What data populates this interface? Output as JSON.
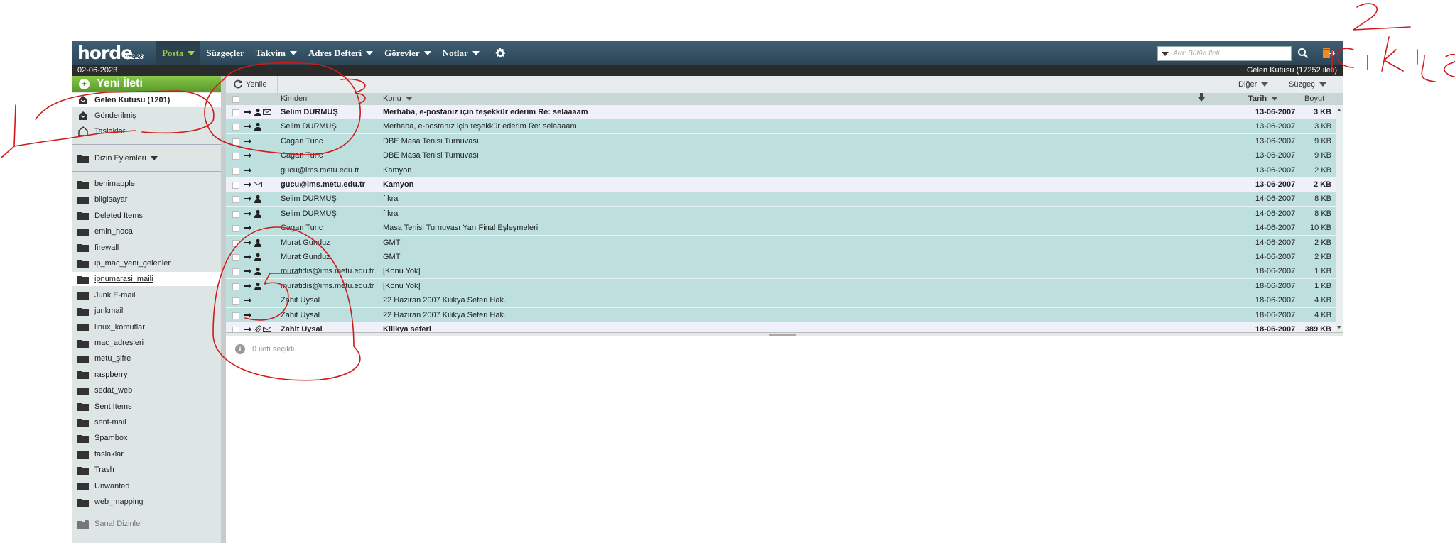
{
  "app": {
    "logo": "horde",
    "version": "5.2.23"
  },
  "nav": {
    "items": [
      {
        "label": "Posta",
        "caret": true,
        "active": true
      },
      {
        "label": "Süzgeçler",
        "caret": false
      },
      {
        "label": "Takvim",
        "caret": true
      },
      {
        "label": "Adres Defteri",
        "caret": true
      },
      {
        "label": "Görevler",
        "caret": true
      },
      {
        "label": "Notlar",
        "caret": true
      }
    ],
    "settings_icon": "gear-icon",
    "search_placeholder": "Ara: Bütün İleti",
    "search_icon": "search-icon",
    "logout_icon": "logout-icon"
  },
  "datebar": {
    "date": "02-06-2023",
    "mailbox_info": "Gelen Kutusu (17252 ileti)"
  },
  "sidebar": {
    "new_message": "Yeni İleti",
    "system_folders": [
      {
        "label": "Gelen Kutusu (1201)",
        "icon": "inbox-icon",
        "bold": true,
        "selected": true
      },
      {
        "label": "Gönderilmiş",
        "icon": "sent-icon"
      },
      {
        "label": "Taslaklar",
        "icon": "drafts-icon"
      }
    ],
    "folder_actions": "Dizin Eylemleri",
    "folders": [
      "benimapple",
      "bilgisayar",
      "Deleted Items",
      "emin_hoca",
      "firewall",
      "ip_mac_yeni_gelenler",
      "ipnumarasi_maili",
      "Junk E-mail",
      "junkmail",
      "linux_komutlar",
      "mac_adresleri",
      "metu_şifre",
      "raspberry",
      "sedat_web",
      "Sent Items",
      "sent-mail",
      "Spambox",
      "taslaklar",
      "Trash",
      "Unwanted",
      "web_mapping"
    ],
    "selected_folder": "ipnumarasi_maili",
    "virtual_folders": "Sanal Dizinler"
  },
  "toolbar": {
    "refresh": "Yenile",
    "other": "Diğer",
    "filter": "Süzgeç"
  },
  "list": {
    "columns": {
      "from": "Kimden",
      "subject": "Konu",
      "date": "Tarih",
      "size": "Boyut"
    },
    "rows": [
      {
        "from": "Selim DURMUŞ",
        "subject": "Merhaba, e-postanız için teşekkür ederim Re: selaaaam",
        "date": "13-06-2007",
        "size": "3 KB",
        "unseen": true,
        "person": true,
        "envelope": true
      },
      {
        "from": "Selim DURMUŞ",
        "subject": "Merhaba, e-postanız için teşekkür ederim Re: selaaaam",
        "date": "13-06-2007",
        "size": "3 KB",
        "person": true
      },
      {
        "from": "Cagan Tunc",
        "subject": "DBE Masa Tenisi Turnuvası",
        "date": "13-06-2007",
        "size": "9 KB"
      },
      {
        "from": "Cagan Tunc",
        "subject": "DBE Masa Tenisi Turnuvası",
        "date": "13-06-2007",
        "size": "9 KB"
      },
      {
        "from": "gucu@ims.metu.edu.tr",
        "subject": "Kamyon",
        "date": "13-06-2007",
        "size": "2 KB"
      },
      {
        "from": "gucu@ims.metu.edu.tr",
        "subject": "Kamyon",
        "date": "13-06-2007",
        "size": "2 KB",
        "unseen": true,
        "envelope": true
      },
      {
        "from": "Selim DURMUŞ",
        "subject": "fıkra",
        "date": "14-06-2007",
        "size": "8 KB",
        "person": true
      },
      {
        "from": "Selim DURMUŞ",
        "subject": "fıkra",
        "date": "14-06-2007",
        "size": "8 KB",
        "person": true
      },
      {
        "from": "Cagan Tunc",
        "subject": "Masa Tenisi Turnuvası Yarı Final Eşleşmeleri",
        "date": "14-06-2007",
        "size": "10 KB"
      },
      {
        "from": "Murat Gunduz",
        "subject": "GMT",
        "date": "14-06-2007",
        "size": "2 KB",
        "person": true
      },
      {
        "from": "Murat Gunduz",
        "subject": "GMT",
        "date": "14-06-2007",
        "size": "2 KB",
        "person": true
      },
      {
        "from": "muratidis@ims.metu.edu.tr",
        "subject": "[Konu Yok]",
        "date": "18-06-2007",
        "size": "1 KB",
        "person": true
      },
      {
        "from": "muratidis@ims.metu.edu.tr",
        "subject": "[Konu Yok]",
        "date": "18-06-2007",
        "size": "1 KB",
        "person": true
      },
      {
        "from": "Zahit Uysal",
        "subject": "22 Haziran 2007 Kilikya Seferi Hak.",
        "date": "18-06-2007",
        "size": "4 KB"
      },
      {
        "from": "Zahit Uysal",
        "subject": "22 Haziran 2007 Kilikya Seferi Hak.",
        "date": "18-06-2007",
        "size": "4 KB"
      },
      {
        "from": "Zahit Uysal",
        "subject": "Kilikya seferi",
        "date": "18-06-2007",
        "size": "389 KB",
        "unseen": true,
        "envelope": true,
        "attachment": true
      }
    ]
  },
  "preview": {
    "status": "0 ileti seçildi."
  },
  "annotations": {
    "handwriting": [
      "1",
      "2",
      "3",
      "5",
      "Çıkış"
    ]
  },
  "colors": {
    "accent_green": "#9dd24b",
    "nav_bg": "#2e4a5b",
    "row_bg": "#bde0df",
    "unseen_bg": "#f0f0fb",
    "annotation": "#d11a1a"
  }
}
